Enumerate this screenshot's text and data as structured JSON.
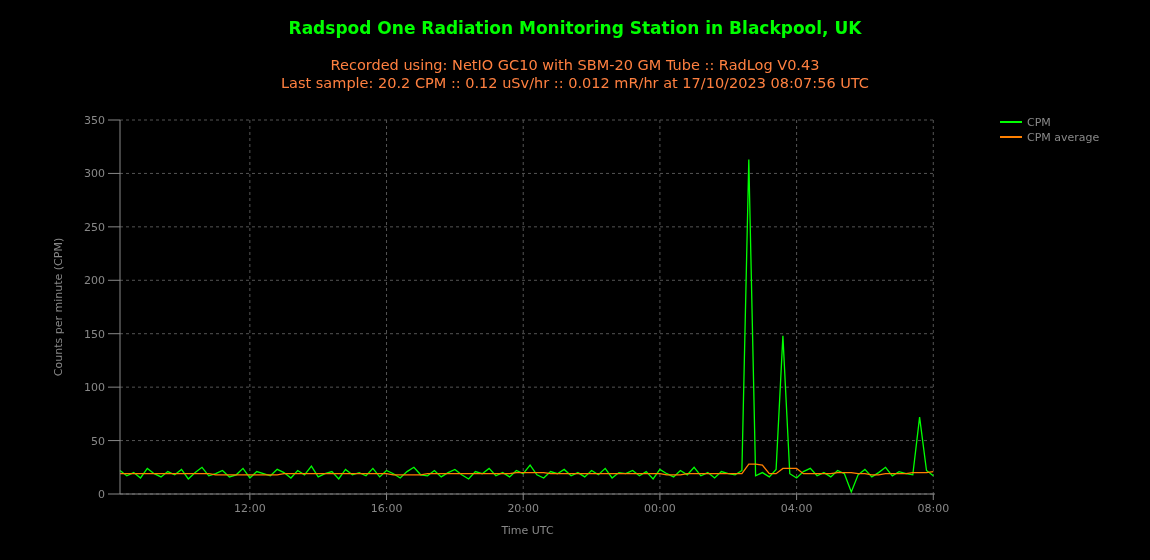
{
  "header": {
    "title": "Radspod One Radiation Monitoring Station in Blackpool, UK",
    "subtitle_lines": [
      "Recorded using: NetIO GC10 with SBM-20 GM Tube :: RadLog V0.43",
      "Last sample: 20.2 CPM :: 0.12 uSv/hr :: 0.012 mR/hr at 17/10/2023 08:07:56 UTC"
    ]
  },
  "chart": {
    "chart_data": {
      "type": "line",
      "xlabel": "Time UTC",
      "ylabel": "Counts per minute (CPM)",
      "x": [
        "2023-10-16T08:12",
        "2023-10-16T08:24",
        "2023-10-16T08:36",
        "2023-10-16T08:48",
        "2023-10-16T09:00",
        "2023-10-16T09:12",
        "2023-10-16T09:24",
        "2023-10-16T09:36",
        "2023-10-16T09:48",
        "2023-10-16T10:00",
        "2023-10-16T10:12",
        "2023-10-16T10:24",
        "2023-10-16T10:36",
        "2023-10-16T10:48",
        "2023-10-16T11:00",
        "2023-10-16T11:12",
        "2023-10-16T11:24",
        "2023-10-16T11:36",
        "2023-10-16T11:48",
        "2023-10-16T12:00",
        "2023-10-16T12:12",
        "2023-10-16T12:24",
        "2023-10-16T12:36",
        "2023-10-16T12:48",
        "2023-10-16T13:00",
        "2023-10-16T13:12",
        "2023-10-16T13:24",
        "2023-10-16T13:36",
        "2023-10-16T13:48",
        "2023-10-16T14:00",
        "2023-10-16T14:12",
        "2023-10-16T14:24",
        "2023-10-16T14:36",
        "2023-10-16T14:48",
        "2023-10-16T15:00",
        "2023-10-16T15:12",
        "2023-10-16T15:24",
        "2023-10-16T15:36",
        "2023-10-16T15:48",
        "2023-10-16T16:00",
        "2023-10-16T16:12",
        "2023-10-16T16:24",
        "2023-10-16T16:36",
        "2023-10-16T16:48",
        "2023-10-16T17:00",
        "2023-10-16T17:12",
        "2023-10-16T17:24",
        "2023-10-16T17:36",
        "2023-10-16T17:48",
        "2023-10-16T18:00",
        "2023-10-16T18:12",
        "2023-10-16T18:24",
        "2023-10-16T18:36",
        "2023-10-16T18:48",
        "2023-10-16T19:00",
        "2023-10-16T19:12",
        "2023-10-16T19:24",
        "2023-10-16T19:36",
        "2023-10-16T19:48",
        "2023-10-16T20:00",
        "2023-10-16T20:12",
        "2023-10-16T20:24",
        "2023-10-16T20:36",
        "2023-10-16T20:48",
        "2023-10-16T21:00",
        "2023-10-16T21:12",
        "2023-10-16T21:24",
        "2023-10-16T21:36",
        "2023-10-16T21:48",
        "2023-10-16T22:00",
        "2023-10-16T22:12",
        "2023-10-16T22:24",
        "2023-10-16T22:36",
        "2023-10-16T22:48",
        "2023-10-16T23:00",
        "2023-10-16T23:12",
        "2023-10-16T23:24",
        "2023-10-16T23:36",
        "2023-10-16T23:48",
        "2023-10-17T00:00",
        "2023-10-17T00:12",
        "2023-10-17T00:24",
        "2023-10-17T00:36",
        "2023-10-17T00:48",
        "2023-10-17T01:00",
        "2023-10-17T01:12",
        "2023-10-17T01:24",
        "2023-10-17T01:36",
        "2023-10-17T01:48",
        "2023-10-17T02:00",
        "2023-10-17T02:12",
        "2023-10-17T02:24",
        "2023-10-17T02:36",
        "2023-10-17T02:48",
        "2023-10-17T03:00",
        "2023-10-17T03:12",
        "2023-10-17T03:24",
        "2023-10-17T03:36",
        "2023-10-17T03:48",
        "2023-10-17T04:00",
        "2023-10-17T04:12",
        "2023-10-17T04:24",
        "2023-10-17T04:36",
        "2023-10-17T04:48",
        "2023-10-17T05:00",
        "2023-10-17T05:12",
        "2023-10-17T05:24",
        "2023-10-17T05:36",
        "2023-10-17T05:48",
        "2023-10-17T06:00",
        "2023-10-17T06:12",
        "2023-10-17T06:24",
        "2023-10-17T06:36",
        "2023-10-17T06:48",
        "2023-10-17T07:00",
        "2023-10-17T07:12",
        "2023-10-17T07:24",
        "2023-10-17T07:36",
        "2023-10-17T07:48",
        "2023-10-17T08:00"
      ],
      "series": [
        {
          "name": "CPM",
          "color": "#00ff00",
          "values": [
            22,
            17,
            20,
            15,
            24,
            19,
            16,
            21,
            18,
            23,
            14,
            20,
            25,
            17,
            19,
            22,
            16,
            18,
            24,
            15,
            21,
            19,
            17,
            23,
            20,
            15,
            22,
            18,
            26,
            16,
            19,
            21,
            14,
            23,
            18,
            20,
            17,
            24,
            16,
            22,
            19,
            15,
            21,
            25,
            18,
            17,
            22,
            16,
            20,
            23,
            18,
            14,
            21,
            19,
            24,
            17,
            20,
            16,
            22,
            19,
            27,
            18,
            15,
            21,
            19,
            23,
            17,
            20,
            16,
            22,
            18,
            24,
            15,
            20,
            19,
            22,
            17,
            21,
            14,
            23,
            19,
            16,
            22,
            18,
            25,
            17,
            20,
            15,
            21,
            19,
            18,
            22,
            313,
            17,
            20,
            16,
            23,
            148,
            19,
            15,
            21,
            24,
            17,
            20,
            16,
            22,
            19,
            2,
            18,
            23,
            16,
            20,
            25,
            17,
            21,
            19,
            18,
            72,
            22,
            17
          ]
        },
        {
          "name": "CPM average",
          "color": "#ff8000",
          "values": [
            19,
            19,
            19,
            19,
            19,
            19,
            19,
            19,
            19,
            19,
            19,
            19,
            19,
            19,
            18,
            18,
            18,
            18,
            18,
            18,
            18,
            18,
            18,
            18,
            19,
            19,
            19,
            19,
            19,
            19,
            19,
            19,
            19,
            19,
            19,
            19,
            19,
            19,
            19,
            19,
            18,
            18,
            18,
            18,
            18,
            19,
            19,
            19,
            19,
            19,
            19,
            19,
            19,
            19,
            19,
            19,
            19,
            19,
            20,
            20,
            20,
            20,
            20,
            19,
            19,
            19,
            19,
            19,
            19,
            19,
            19,
            19,
            19,
            19,
            19,
            19,
            19,
            19,
            19,
            19,
            18,
            18,
            18,
            19,
            19,
            19,
            19,
            19,
            19,
            19,
            19,
            19,
            28,
            28,
            27,
            19,
            19,
            24,
            24,
            24,
            19,
            19,
            19,
            19,
            19,
            20,
            20,
            20,
            19,
            19,
            18,
            18,
            19,
            19,
            19,
            19,
            20,
            20,
            20,
            21
          ]
        }
      ],
      "xlim": [
        "2023-10-16T08:12",
        "2023-10-17T08:03"
      ],
      "ylim": [
        0,
        350
      ],
      "xticks": [
        {
          "value": "2023-10-16T12:00",
          "label": "12:00"
        },
        {
          "value": "2023-10-16T16:00",
          "label": "16:00"
        },
        {
          "value": "2023-10-16T20:00",
          "label": "20:00"
        },
        {
          "value": "2023-10-17T00:00",
          "label": "00:00"
        },
        {
          "value": "2023-10-17T04:00",
          "label": "04:00"
        },
        {
          "value": "2023-10-17T08:00",
          "label": "08:00"
        }
      ],
      "grid": true,
      "legend": true,
      "yticks": [
        0,
        50,
        100,
        150,
        200,
        250,
        300,
        350
      ]
    }
  }
}
